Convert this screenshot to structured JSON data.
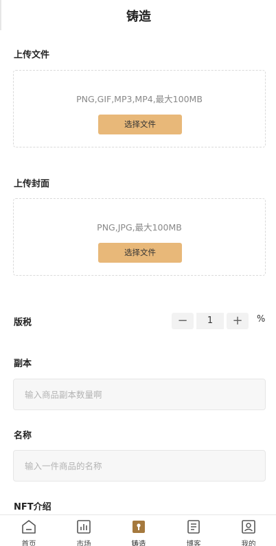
{
  "header": {
    "title": "铸造"
  },
  "upload_file": {
    "label": "上传文件",
    "hint": "PNG,GIF,MP3,MP4,最大100MB",
    "button_label": "选择文件"
  },
  "upload_cover": {
    "label": "上传封面",
    "hint": "PNG,JPG,最大100MB",
    "button_label": "选择文件"
  },
  "royalty": {
    "label": "版税",
    "minus": "−",
    "value": "1",
    "plus": "+",
    "unit": "%"
  },
  "copies": {
    "label": "副本",
    "placeholder": "输入商品副本数量啊"
  },
  "name": {
    "label": "名称",
    "placeholder": "输入一件商品的名称"
  },
  "nft_intro": {
    "label": "NFT介绍"
  },
  "tabbar": {
    "items": [
      {
        "label": "首页",
        "icon": "home-icon",
        "active": false
      },
      {
        "label": "市场",
        "icon": "market-chart-icon",
        "active": false
      },
      {
        "label": "铸造",
        "icon": "mint-icon",
        "active": true
      },
      {
        "label": "博客",
        "icon": "blog-document-icon",
        "active": false
      },
      {
        "label": "我的",
        "icon": "profile-icon",
        "active": false
      }
    ]
  },
  "colors": {
    "accent": "#e8b879",
    "active_icon": "#a5793e",
    "inactive_icon": "#555555"
  }
}
